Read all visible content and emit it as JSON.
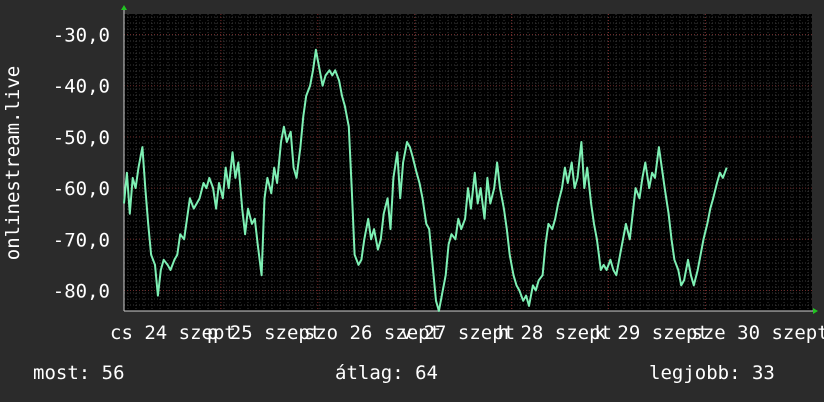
{
  "chart_data": {
    "type": "line",
    "ylabel": "onlinestream.live",
    "ylim": [
      -84,
      -26
    ],
    "yticks": [
      {
        "value": -30,
        "label": "-30,0"
      },
      {
        "value": -40,
        "label": "-40,0"
      },
      {
        "value": -50,
        "label": "-50,0"
      },
      {
        "value": -60,
        "label": "-60,0"
      },
      {
        "value": -70,
        "label": "-70,0"
      },
      {
        "value": -80,
        "label": "-80,0"
      }
    ],
    "xlim": [
      0,
      7.1
    ],
    "xticks": [
      {
        "value": 0.0,
        "label": "cs 24 szept"
      },
      {
        "value": 1.0,
        "label": "p 25 szept"
      },
      {
        "value": 2.0,
        "label": "szo 26 szept"
      },
      {
        "value": 3.0,
        "label": "v 27 szept"
      },
      {
        "value": 4.0,
        "label": "h 28 szept"
      },
      {
        "value": 5.0,
        "label": "k 29 szept"
      },
      {
        "value": 6.0,
        "label": "sze 30 szept"
      }
    ],
    "grid": true,
    "line_color": "#7ef0b4",
    "series": [
      {
        "points": [
          [
            0.0,
            -63
          ],
          [
            0.03,
            -57
          ],
          [
            0.06,
            -65
          ],
          [
            0.09,
            -58
          ],
          [
            0.12,
            -60
          ],
          [
            0.15,
            -56
          ],
          [
            0.19,
            -52
          ],
          [
            0.22,
            -60
          ],
          [
            0.25,
            -67
          ],
          [
            0.28,
            -73
          ],
          [
            0.32,
            -75
          ],
          [
            0.35,
            -81
          ],
          [
            0.38,
            -76
          ],
          [
            0.41,
            -74
          ],
          [
            0.45,
            -75
          ],
          [
            0.48,
            -76
          ],
          [
            0.52,
            -74
          ],
          [
            0.55,
            -73
          ],
          [
            0.58,
            -69
          ],
          [
            0.62,
            -70
          ],
          [
            0.65,
            -66
          ],
          [
            0.68,
            -62
          ],
          [
            0.72,
            -64
          ],
          [
            0.75,
            -63
          ],
          [
            0.78,
            -62
          ],
          [
            0.82,
            -59
          ],
          [
            0.85,
            -60
          ],
          [
            0.88,
            -58
          ],
          [
            0.92,
            -60
          ],
          [
            0.95,
            -64
          ],
          [
            0.98,
            -59
          ],
          [
            1.02,
            -62
          ],
          [
            1.05,
            -56
          ],
          [
            1.08,
            -60
          ],
          [
            1.12,
            -53
          ],
          [
            1.15,
            -58
          ],
          [
            1.18,
            -55
          ],
          [
            1.22,
            -64
          ],
          [
            1.25,
            -69
          ],
          [
            1.28,
            -64
          ],
          [
            1.32,
            -67
          ],
          [
            1.35,
            -66
          ],
          [
            1.38,
            -71
          ],
          [
            1.42,
            -77
          ],
          [
            1.45,
            -62
          ],
          [
            1.48,
            -58
          ],
          [
            1.52,
            -61
          ],
          [
            1.55,
            -56
          ],
          [
            1.58,
            -59
          ],
          [
            1.62,
            -51
          ],
          [
            1.65,
            -48
          ],
          [
            1.68,
            -51
          ],
          [
            1.72,
            -49
          ],
          [
            1.75,
            -56
          ],
          [
            1.78,
            -58
          ],
          [
            1.82,
            -52
          ],
          [
            1.85,
            -46
          ],
          [
            1.88,
            -42
          ],
          [
            1.92,
            -40
          ],
          [
            1.95,
            -37
          ],
          [
            1.98,
            -33
          ],
          [
            2.02,
            -37
          ],
          [
            2.05,
            -40
          ],
          [
            2.08,
            -38
          ],
          [
            2.12,
            -37
          ],
          [
            2.15,
            -38
          ],
          [
            2.18,
            -37
          ],
          [
            2.22,
            -39
          ],
          [
            2.25,
            -42
          ],
          [
            2.28,
            -44
          ],
          [
            2.32,
            -48
          ],
          [
            2.35,
            -60
          ],
          [
            2.38,
            -73
          ],
          [
            2.42,
            -75
          ],
          [
            2.45,
            -74
          ],
          [
            2.48,
            -70
          ],
          [
            2.52,
            -66
          ],
          [
            2.55,
            -70
          ],
          [
            2.58,
            -68
          ],
          [
            2.62,
            -72
          ],
          [
            2.65,
            -70
          ],
          [
            2.68,
            -65
          ],
          [
            2.72,
            -62
          ],
          [
            2.75,
            -68
          ],
          [
            2.78,
            -58
          ],
          [
            2.82,
            -53
          ],
          [
            2.85,
            -62
          ],
          [
            2.88,
            -55
          ],
          [
            2.92,
            -51
          ],
          [
            2.95,
            -52
          ],
          [
            2.98,
            -54
          ],
          [
            3.02,
            -57
          ],
          [
            3.05,
            -59
          ],
          [
            3.08,
            -62
          ],
          [
            3.12,
            -67
          ],
          [
            3.15,
            -68
          ],
          [
            3.18,
            -74
          ],
          [
            3.22,
            -82
          ],
          [
            3.25,
            -84
          ],
          [
            3.28,
            -81
          ],
          [
            3.32,
            -77
          ],
          [
            3.35,
            -71
          ],
          [
            3.38,
            -69
          ],
          [
            3.42,
            -70
          ],
          [
            3.45,
            -66
          ],
          [
            3.48,
            -68
          ],
          [
            3.52,
            -66
          ],
          [
            3.55,
            -60
          ],
          [
            3.58,
            -64
          ],
          [
            3.62,
            -57
          ],
          [
            3.65,
            -63
          ],
          [
            3.68,
            -60
          ],
          [
            3.72,
            -66
          ],
          [
            3.75,
            -58
          ],
          [
            3.78,
            -63
          ],
          [
            3.82,
            -60
          ],
          [
            3.85,
            -55
          ],
          [
            3.88,
            -60
          ],
          [
            3.92,
            -64
          ],
          [
            3.95,
            -68
          ],
          [
            3.98,
            -73
          ],
          [
            4.02,
            -77
          ],
          [
            4.05,
            -79
          ],
          [
            4.08,
            -80
          ],
          [
            4.12,
            -82
          ],
          [
            4.15,
            -81
          ],
          [
            4.18,
            -83
          ],
          [
            4.22,
            -79
          ],
          [
            4.25,
            -80
          ],
          [
            4.28,
            -78
          ],
          [
            4.32,
            -77
          ],
          [
            4.35,
            -71
          ],
          [
            4.38,
            -67
          ],
          [
            4.42,
            -68
          ],
          [
            4.45,
            -66
          ],
          [
            4.48,
            -63
          ],
          [
            4.52,
            -60
          ],
          [
            4.55,
            -56
          ],
          [
            4.58,
            -59
          ],
          [
            4.62,
            -55
          ],
          [
            4.65,
            -60
          ],
          [
            4.68,
            -58
          ],
          [
            4.72,
            -51
          ],
          [
            4.75,
            -60
          ],
          [
            4.78,
            -56
          ],
          [
            4.82,
            -63
          ],
          [
            4.85,
            -67
          ],
          [
            4.88,
            -70
          ],
          [
            4.92,
            -76
          ],
          [
            4.95,
            -75
          ],
          [
            4.98,
            -76
          ],
          [
            5.02,
            -74
          ],
          [
            5.05,
            -76
          ],
          [
            5.08,
            -77
          ],
          [
            5.12,
            -73
          ],
          [
            5.15,
            -70
          ],
          [
            5.18,
            -67
          ],
          [
            5.22,
            -70
          ],
          [
            5.25,
            -65
          ],
          [
            5.28,
            -60
          ],
          [
            5.32,
            -62
          ],
          [
            5.35,
            -58
          ],
          [
            5.38,
            -55
          ],
          [
            5.42,
            -60
          ],
          [
            5.45,
            -57
          ],
          [
            5.48,
            -58
          ],
          [
            5.52,
            -52
          ],
          [
            5.55,
            -56
          ],
          [
            5.58,
            -60
          ],
          [
            5.62,
            -65
          ],
          [
            5.65,
            -70
          ],
          [
            5.68,
            -74
          ],
          [
            5.72,
            -76
          ],
          [
            5.75,
            -79
          ],
          [
            5.78,
            -78
          ],
          [
            5.82,
            -74
          ],
          [
            5.85,
            -77
          ],
          [
            5.88,
            -79
          ],
          [
            5.92,
            -76
          ],
          [
            5.95,
            -73
          ],
          [
            5.98,
            -70
          ],
          [
            6.02,
            -67
          ],
          [
            6.05,
            -64
          ],
          [
            6.08,
            -62
          ],
          [
            6.12,
            -59
          ],
          [
            6.15,
            -57
          ],
          [
            6.18,
            -58
          ],
          [
            6.22,
            -56
          ]
        ]
      }
    ]
  },
  "stats": {
    "now": "most: 56",
    "avg": "átlag: 64",
    "best": "legjobb: 33"
  }
}
